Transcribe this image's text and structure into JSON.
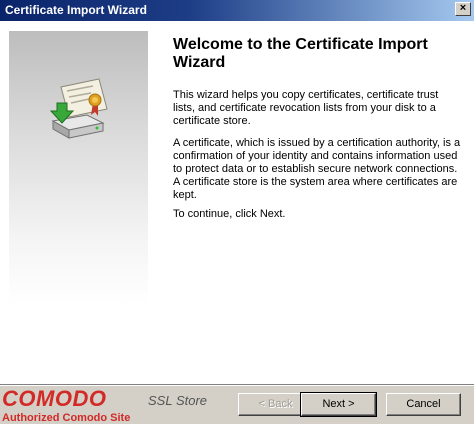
{
  "window": {
    "title": "Certificate Import Wizard",
    "close_glyph": "×"
  },
  "main": {
    "heading": "Welcome to the Certificate Import Wizard",
    "paragraphs": [
      "This wizard helps you copy certificates, certificate trust lists, and certificate revocation lists from your disk to a certificate store.",
      "A certificate, which is issued by a certification authority, is a confirmation of your identity and contains information used to protect data or to establish secure network connections. A certificate store is the system area where certificates are kept.",
      "To continue, click Next."
    ]
  },
  "buttons": {
    "back": "< Back",
    "next": "Next >",
    "cancel": "Cancel"
  },
  "watermark": {
    "brand": "COMODO",
    "suffix": "SSL Store",
    "tagline": "Authorized Comodo Site"
  },
  "colors": {
    "title_bar": "#0a246a",
    "brand_red": "#d12a27",
    "dialog_face": "#d4d0c8"
  },
  "icons": {
    "wizard_graphic": "certificate-drive-icon"
  }
}
